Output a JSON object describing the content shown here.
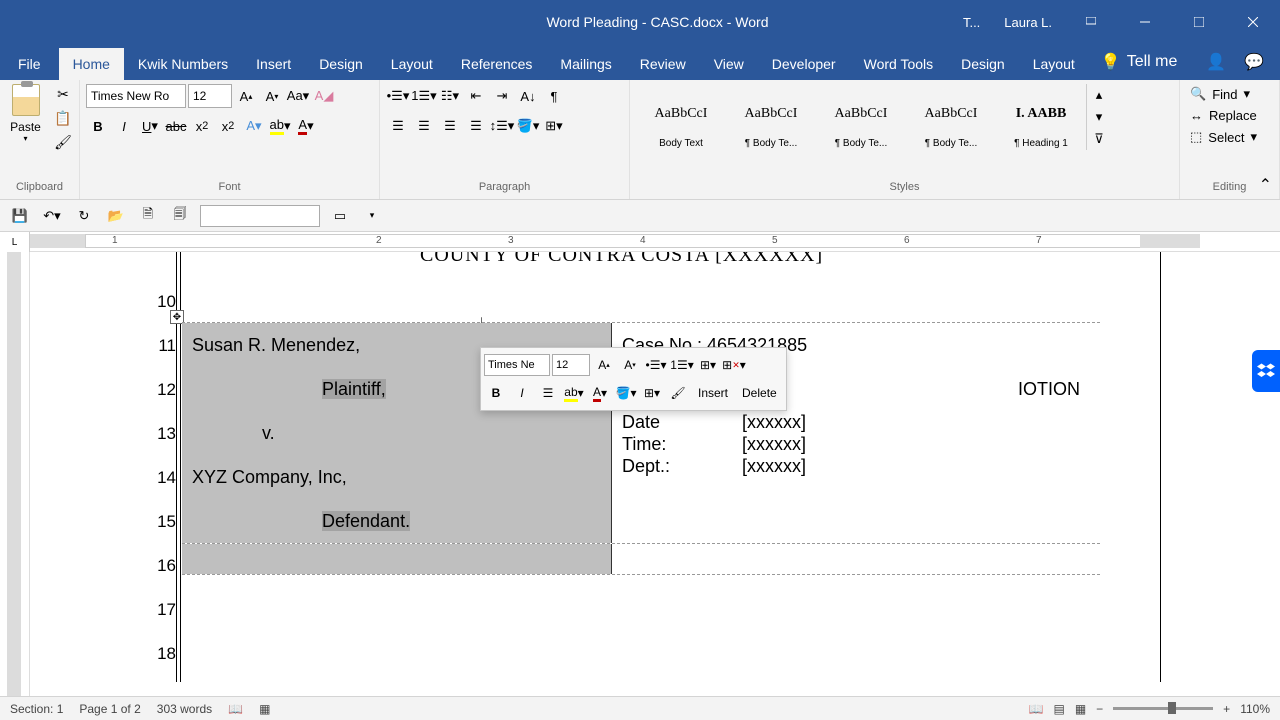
{
  "titlebar": {
    "title": "Word Pleading - CASC.docx  -  Word",
    "user_initial": "T...",
    "user_name": "Laura L."
  },
  "tabs": {
    "file": "File",
    "home": "Home",
    "kwik": "Kwik Numbers",
    "insert": "Insert",
    "design": "Design",
    "layout": "Layout",
    "references": "References",
    "mailings": "Mailings",
    "review": "Review",
    "view": "View",
    "developer": "Developer",
    "wordtools": "Word Tools",
    "design2": "Design",
    "layout2": "Layout",
    "tellme": "Tell me"
  },
  "ribbon": {
    "clipboard": {
      "label": "Clipboard",
      "paste": "Paste"
    },
    "font": {
      "label": "Font",
      "name": "Times New Ro",
      "size": "12"
    },
    "paragraph": {
      "label": "Paragraph"
    },
    "styles": {
      "label": "Styles",
      "items": [
        {
          "preview": "AaBbCcI",
          "name": "Body Text"
        },
        {
          "preview": "AaBbCcI",
          "name": "¶ Body Te..."
        },
        {
          "preview": "AaBbCcI",
          "name": "¶ Body Te..."
        },
        {
          "preview": "AaBbCcI",
          "name": "¶ Body Te..."
        },
        {
          "preview": "I.  AABB",
          "name": "¶ Heading 1"
        }
      ]
    },
    "editing": {
      "label": "Editing",
      "find": "Find",
      "replace": "Replace",
      "select": "Select"
    }
  },
  "mini": {
    "font": "Times Ne",
    "size": "12",
    "insert": "Insert",
    "delete": "Delete"
  },
  "document": {
    "header_fragment": "COUNTY OF CONTRA COSTA  [XXXXXX]",
    "line_numbers": [
      "10",
      "11",
      "12",
      "13",
      "14",
      "15",
      "16",
      "17",
      "18"
    ],
    "plaintiff_name": "Susan R. Menendez,",
    "plaintiff_role": "Plaintiff,",
    "versus": "v.",
    "defendant_name": "XYZ Company, Inc,",
    "defendant_role": "Defendant.",
    "case_no": "Case No.: 4654321885",
    "motion_fragment": "IOTION",
    "date_label": "Date",
    "date_val": "[xxxxxx]",
    "time_label": "Time:",
    "time_val": "[xxxxxx]",
    "dept_label": "Dept.:",
    "dept_val": "[xxxxxx]"
  },
  "statusbar": {
    "section": "Section: 1",
    "page": "Page 1 of 2",
    "words": "303 words",
    "zoom": "110%"
  },
  "ruler_numbers": [
    "1",
    "2",
    "3",
    "4",
    "5",
    "6",
    "7"
  ]
}
